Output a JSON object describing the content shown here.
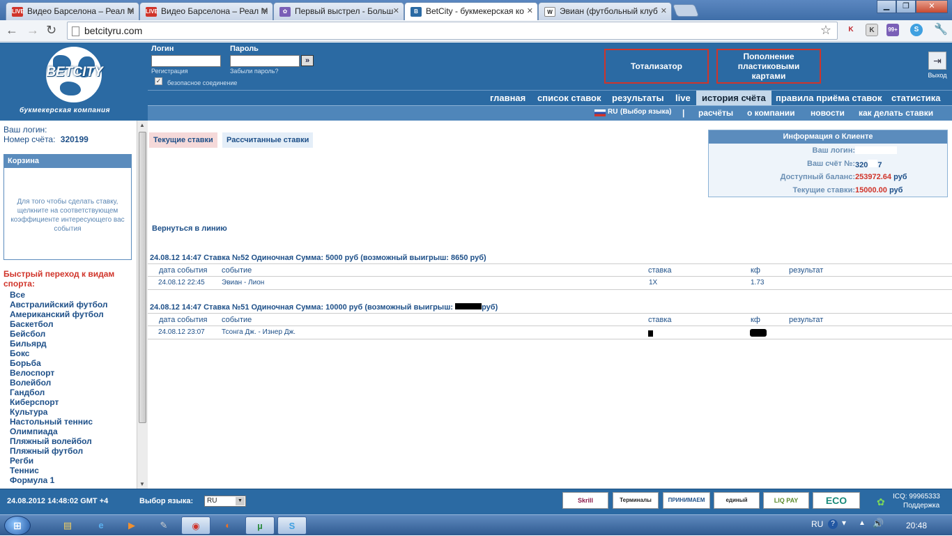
{
  "browser": {
    "tabs": [
      {
        "title": "Видео Барселона – Реал М",
        "fav": "LIVE",
        "favcolor": "#d0342a"
      },
      {
        "title": "Видео Барселона – Реал М",
        "fav": "LIVE",
        "favcolor": "#d0342a"
      },
      {
        "title": "Первый выстрел - Больш",
        "fav": "✿",
        "favcolor": "#7a5fb7"
      },
      {
        "title": "BetCity - букмекерская ко",
        "fav": "B",
        "favcolor": "#2b6aa3"
      },
      {
        "title": "Эвиан (футбольный клуб",
        "fav": "W",
        "favcolor": "#666666"
      }
    ],
    "url": "betcityru.com",
    "ext_badge": "99+"
  },
  "header": {
    "logo_text": "BETCITY",
    "logo_sub": "букмекерская компания",
    "login_label": "Логин",
    "password_label": "Пароль",
    "register": "Регистрация",
    "forgot": "Забыли пароль?",
    "secure": "безопасное соединение",
    "go": "»",
    "btn_totalizator": "Тотализатор",
    "btn_cards": "Пополнение пластиковыми картами",
    "exit": "Выход"
  },
  "menu1": [
    "главная",
    "список ставок",
    "результаты",
    "live",
    "история счёта",
    "правила приёма ставок",
    "статистика"
  ],
  "menu2": {
    "lang": "RU",
    "lang_choice": "(Выбор языка)",
    "sep": "|",
    "items": [
      "расчёты",
      "о компании",
      "новости",
      "как делать ставки"
    ]
  },
  "left": {
    "login_label": "Ваш логин:",
    "account_label": "Номер счёта:",
    "account_value": "320199",
    "basket_title": "Корзина",
    "basket_text": "Для того чтобы сделать ставку, щелкните на соответствующем коэффициенте интересующего вас события",
    "sports_title": "Быстрый переход к видам спорта:",
    "sports": [
      "Все",
      "Австралийский футбол",
      "Американский футбол",
      "Баскетбол",
      "Бейсбол",
      "Бильярд",
      "Бокс",
      "Борьба",
      "Велоспорт",
      "Волейбол",
      "Гандбол",
      "Киберспорт",
      "Культура",
      "Настольный теннис",
      "Олимпиада",
      "Пляжный волейбол",
      "Пляжный футбол",
      "Регби",
      "Теннис",
      "Формула 1"
    ]
  },
  "main": {
    "tab_current": "Текущие ставки",
    "tab_calculated": "Рассчитанные ставки",
    "back": "Вернуться в линию",
    "info": {
      "title": "Информация о Клиенте",
      "login_k": "Ваш логин:",
      "account_k": "Ваш счёт №:",
      "account_v1": "320",
      "account_v2": "7",
      "balance_k": "Доступный баланс:",
      "balance_v": "253972.64",
      "current_k": "Текущие ставки:",
      "current_v": "15000.00",
      "currency": "руб"
    },
    "columns": [
      "дата события",
      "событие",
      "ставка",
      "кф",
      "результат"
    ],
    "bets": [
      {
        "header": "24.08.12 14:47  Ставка №52  Одиночная  Сумма: 5000 руб (возможный выигрыш: 8650 руб)",
        "date": "24.08.12 22:45",
        "event": "Эвиан - Лион",
        "stake": "1X",
        "coef": "1.73",
        "result": ""
      },
      {
        "header_a": "24.08.12 14:47  Ставка №51  Одиночная  Сумма: 10000 руб (возможный выигрыш: ",
        "header_b": "руб)",
        "date": "24.08.12 23:07",
        "event": "Тсонга Дж. - Изнер Дж.",
        "stake": "",
        "coef": "",
        "result": ""
      }
    ]
  },
  "status": {
    "datetime": "24.08.2012  14:48:02  GMT +4",
    "lang_label": "Выбор языка:",
    "lang_value": "RU",
    "payments": [
      "Skrill moneybookers",
      "Терминалы России",
      "ПРИНИМАЕМ WebMoney",
      "единый кошелек",
      "LIQ PAY",
      "ECO"
    ],
    "icq": "ICQ: 99965333",
    "support": "Поддержка"
  },
  "taskbar": {
    "lang": "RU",
    "time": "20:48"
  }
}
